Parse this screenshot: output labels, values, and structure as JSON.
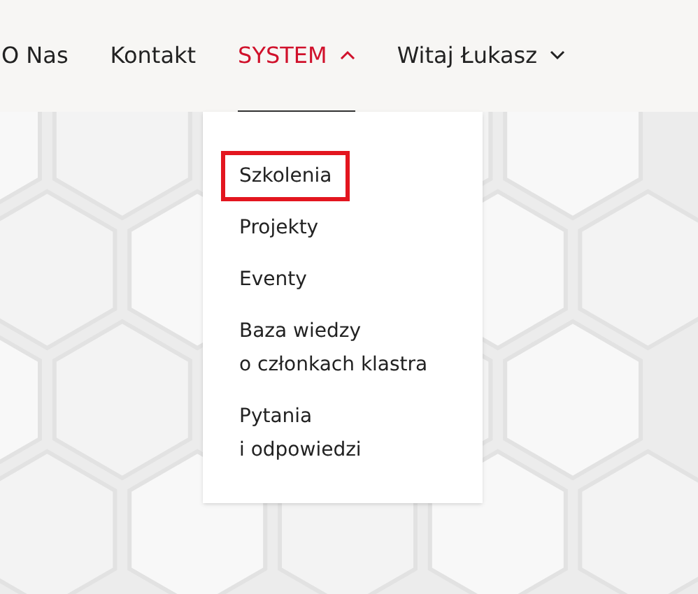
{
  "nav": {
    "items": [
      {
        "label": "O Nas",
        "kind": "link",
        "selected": false
      },
      {
        "label": "Kontakt",
        "kind": "link",
        "selected": false
      },
      {
        "label": "SYSTEM",
        "kind": "menu",
        "selected": true,
        "expanded": true
      },
      {
        "label": "Witaj Łukasz",
        "kind": "menu",
        "selected": false,
        "expanded": false
      }
    ]
  },
  "dropdown": {
    "items": [
      {
        "lines": [
          "Szkolenia"
        ],
        "highlighted": true
      },
      {
        "lines": [
          "Projekty"
        ],
        "highlighted": false
      },
      {
        "lines": [
          "Eventy"
        ],
        "highlighted": false
      },
      {
        "lines": [
          "Baza wiedzy",
          "o członkach klastra"
        ],
        "highlighted": false
      },
      {
        "lines": [
          "Pytania",
          "i odpowiedzi"
        ],
        "highlighted": false
      }
    ]
  }
}
